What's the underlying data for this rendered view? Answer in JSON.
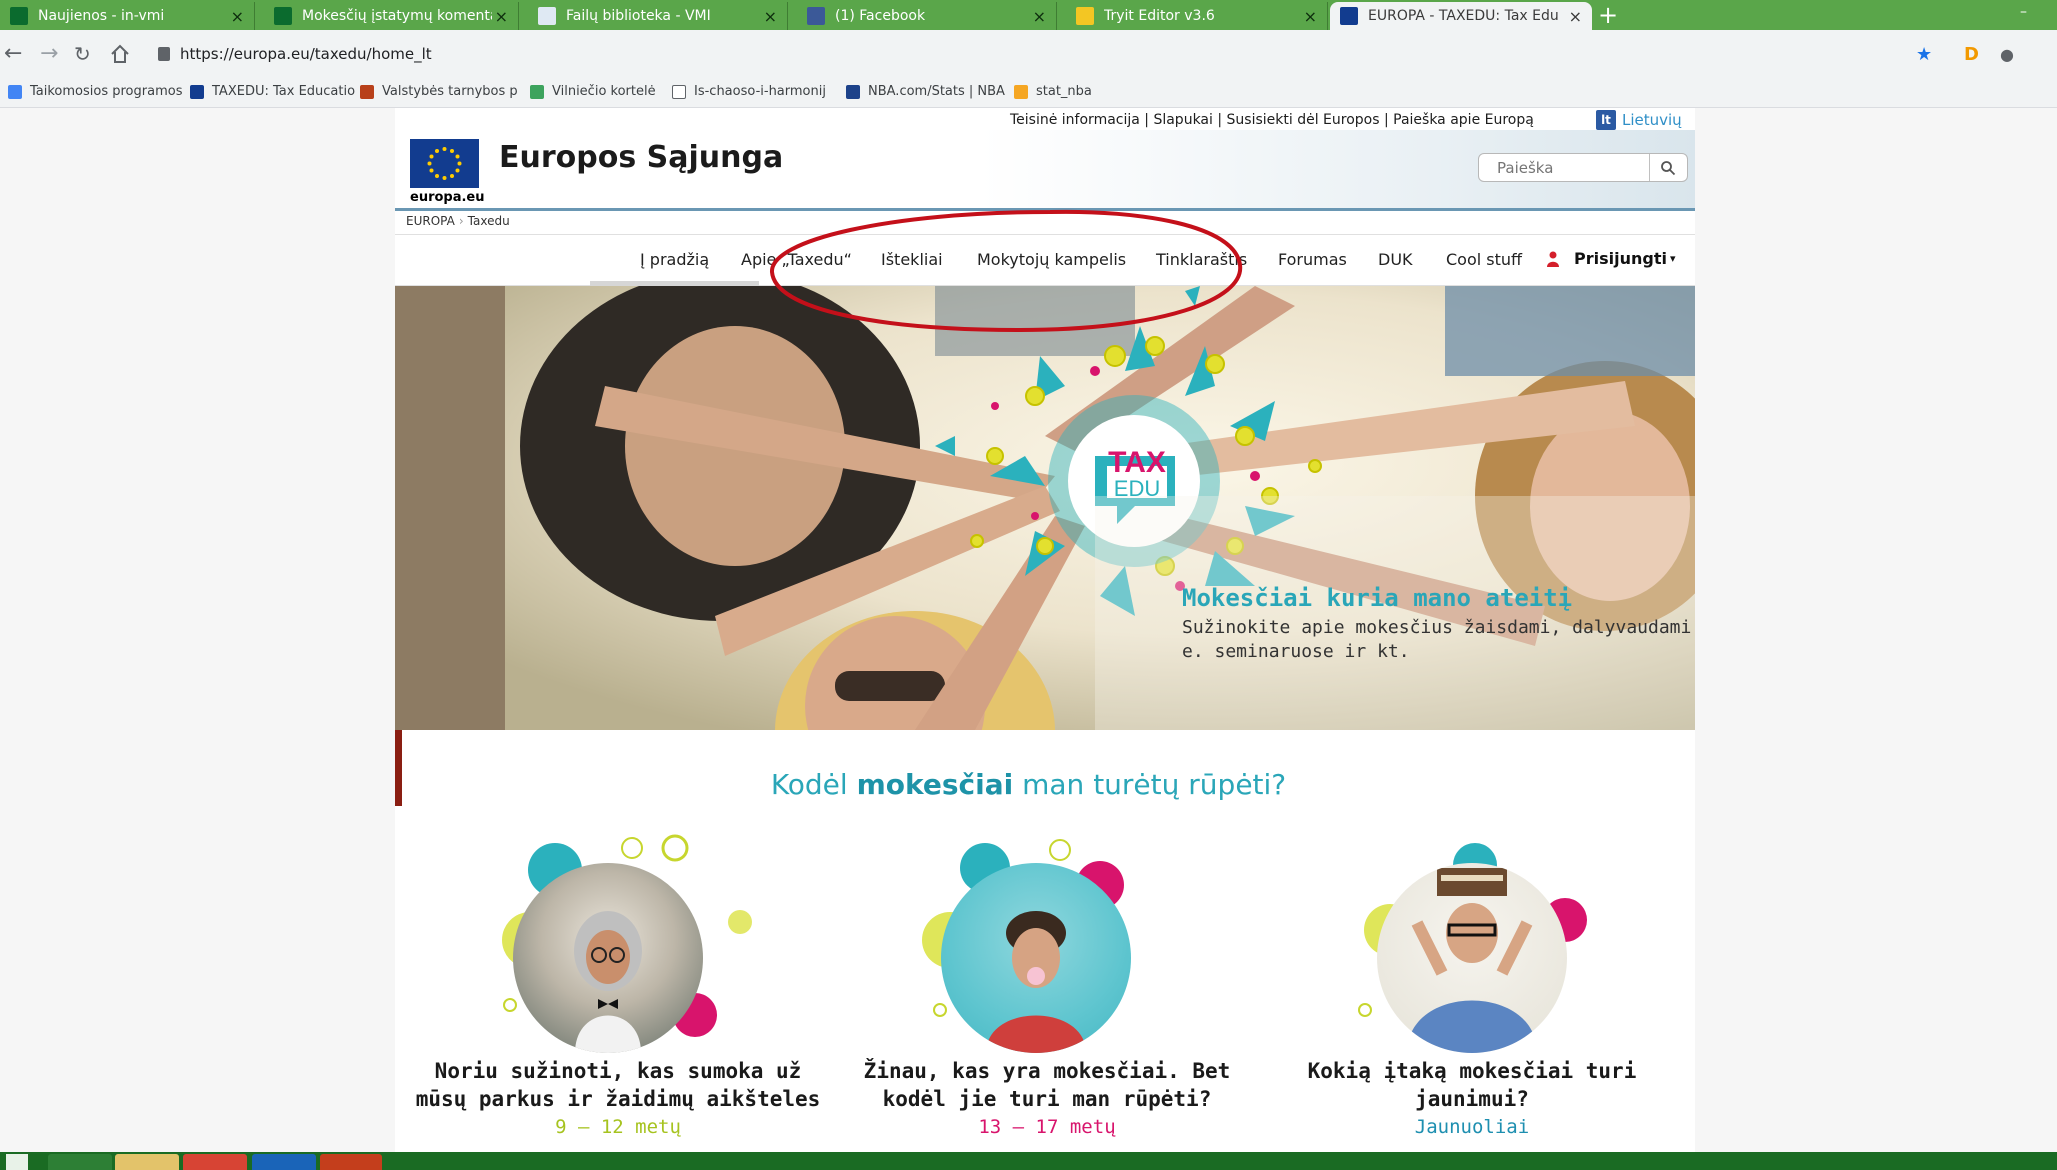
{
  "browser": {
    "tabs": [
      {
        "title": "Naujienos - in-vmi"
      },
      {
        "title": "Mokesčių įstatymų komentarų p"
      },
      {
        "title": "Failų biblioteka - VMI"
      },
      {
        "title": "(1) Facebook"
      },
      {
        "title": "Tryit Editor v3.6"
      },
      {
        "title": "EUROPA - TAXEDU: Tax Educatio"
      }
    ],
    "tab_close": "×",
    "new_tab": "+",
    "url": "https://europa.eu/taxedu/home_lt",
    "bookmarks": [
      {
        "label": "Taikomosios programos"
      },
      {
        "label": "TAXEDU: Tax Educatio"
      },
      {
        "label": "Valstybės tarnybos p"
      },
      {
        "label": "Vilniečio kortelė"
      },
      {
        "label": "Is-chaoso-i-harmonij"
      },
      {
        "label": "NBA.com/Stats | NBA"
      },
      {
        "label": "stat_nba"
      }
    ]
  },
  "site": {
    "top_links": "Teisinė informacija | Slapukai | Susisiekti dėl Europos | Paieška apie Europą",
    "language": "Lietuvių",
    "language_code": "lt",
    "eu_domain": "europa.eu",
    "eu_title": "Europos Sąjunga",
    "search_placeholder": "Paieška",
    "breadcrumb": [
      "EUROPA",
      "Taxedu"
    ],
    "menu": [
      "Į pradžią",
      "Apie „Taxedu“",
      "Ištekliai",
      "Mokytojų kampelis",
      "Tinklaraštis",
      "Forumas",
      "DUK",
      "Cool stuff"
    ],
    "login": "Prisijungti",
    "hero": {
      "logo_line1": "TAX",
      "logo_line2": "EDU",
      "headline": "Mokesčiai kuria mano ateitį",
      "subtext": "Sužinokite apie mokesčius žaisdami, dalyvaudami e. seminaruose ir kt."
    },
    "why": {
      "prefix": "Kodėl ",
      "bold": "mokesčiai",
      "suffix": " man turėtų rūpėti?"
    },
    "audiences": [
      {
        "question": "Noriu sužinoti, kas sumoka už mūsų parkus ir žaidimų aikšteles",
        "age": "9 – 12 metų",
        "color": "#a6c31f"
      },
      {
        "question": "Žinau, kas yra mokesčiai. Bet kodėl jie turi man rūpėti?",
        "age": "13 – 17 metų",
        "color": "#d8146c"
      },
      {
        "question": "Kokią įtaką mokesčiai turi jaunimui?",
        "age": "Jaunuoliai",
        "color": "#1e8fb0"
      }
    ]
  },
  "colors": {
    "tabbar": "#5aa64a",
    "taskbar": "#1a6b23",
    "accent": "#2aa6b8",
    "annotation": "#c4101a"
  }
}
